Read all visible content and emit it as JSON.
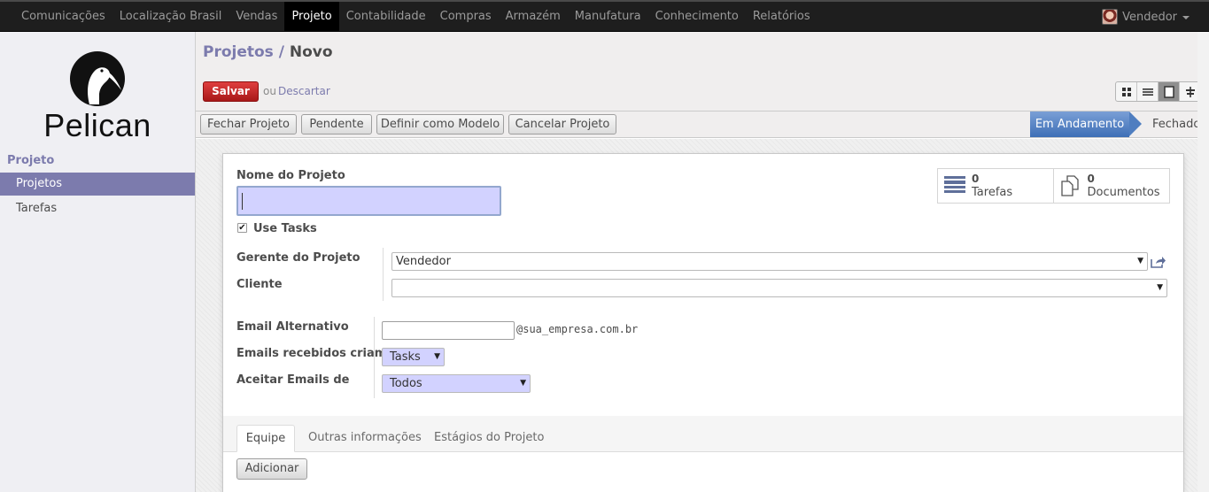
{
  "topbar": {
    "menu": [
      "Comunicações",
      "Localização Brasil",
      "Vendas",
      "Projeto",
      "Contabilidade",
      "Compras",
      "Armazém",
      "Manufatura",
      "Conhecimento",
      "Relatórios"
    ],
    "active_index": 3,
    "user_name": "Vendedor"
  },
  "sidebar": {
    "logo_text": "Pelican",
    "section_title": "Projeto",
    "items": [
      {
        "label": "Projetos",
        "active": true
      },
      {
        "label": "Tarefas",
        "active": false
      }
    ]
  },
  "header": {
    "breadcrumb_parent": "Projetos",
    "breadcrumb_sep": "/",
    "breadcrumb_current": "Novo",
    "save_label": "Salvar",
    "or_text": "ou",
    "discard_label": "Descartar",
    "views": [
      "kanban",
      "list",
      "form",
      "gantt"
    ],
    "active_view": "form"
  },
  "statusbar": {
    "buttons": [
      "Fechar Projeto",
      "Pendente",
      "Definir como Modelo",
      "Cancelar Projeto"
    ],
    "stages": [
      "Em Andamento",
      "Fechado"
    ],
    "active_stage": "Em Andamento"
  },
  "form": {
    "name_label": "Nome do Projeto",
    "name_value": "",
    "use_tasks_label": "Use Tasks",
    "use_tasks_checked": true,
    "smart_buttons": [
      {
        "count": "0",
        "label": "Tarefas",
        "icon": "tasks-icon"
      },
      {
        "count": "0",
        "label": "Documentos",
        "icon": "documents-icon"
      }
    ],
    "manager_label": "Gerente do Projeto",
    "manager_value": "Vendedor",
    "customer_label": "Cliente",
    "customer_value": "",
    "alias_label": "Email Alternativo",
    "alias_value": "",
    "alias_suffix": "@sua_empresa.com.br",
    "alias_model_label": "Emails recebidos criam",
    "alias_model_value": "Tasks",
    "accept_label": "Aceitar Emails de",
    "accept_value": "Todos"
  },
  "tabs": {
    "items": [
      "Equipe",
      "Outras informações",
      "Estágios do Projeto"
    ],
    "active_index": 0,
    "add_label": "Adicionar"
  },
  "colors": {
    "accent": "#7c7bad",
    "save_button": "#c62828",
    "stage_active": "#4f7ec0",
    "required_field": "#d2d2ff"
  }
}
